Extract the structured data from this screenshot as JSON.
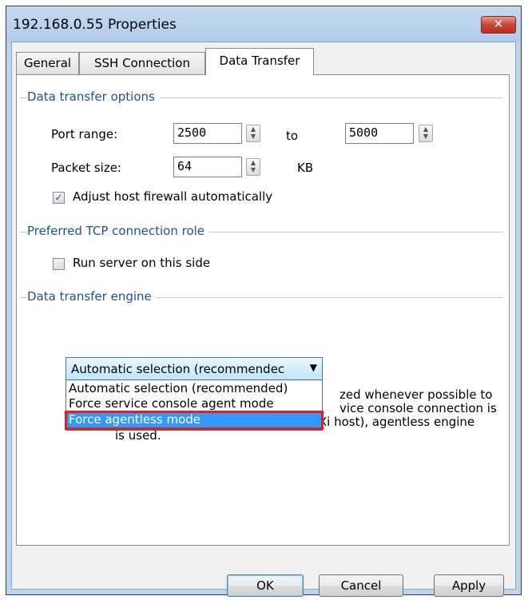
{
  "window": {
    "title": "192.168.0.55 Properties",
    "close_glyph": "✕"
  },
  "tabs": [
    {
      "label": "General"
    },
    {
      "label": "SSH Connection"
    },
    {
      "label": "Data Transfer",
      "active": true
    }
  ],
  "data_transfer_options": {
    "title": "Data transfer options",
    "port_range_label": "Port range:",
    "port_from": "2500",
    "to_label": "to",
    "port_to": "5000",
    "packet_size_label": "Packet size:",
    "packet_size": "64",
    "packet_unit": "KB",
    "firewall_label": "Adjust host firewall automatically",
    "firewall_checked": true
  },
  "tcp_role": {
    "title": "Preferred TCP connection role",
    "run_server_label": "Run server on this side",
    "run_server_checked": false
  },
  "engine": {
    "title": "Data transfer engine",
    "selected": "Automatic selection (recommendec",
    "options": [
      "Automatic selection (recommended)",
      "Force service console agent mode",
      "Force agentless mode"
    ],
    "highlighted_index": 2,
    "description_line1": "zed whenever possible to",
    "description_line2": "vice console connection is",
    "description_line3": "unavailable (such as in case of ESXi host), agentless engine",
    "description_line4": "is used."
  },
  "buttons": {
    "ok": "OK",
    "cancel": "Cancel",
    "apply": "Apply"
  },
  "colors": {
    "section_title": "#1f4f9c",
    "highlight": "#3399ff",
    "annotation_box": "#e0201a"
  }
}
